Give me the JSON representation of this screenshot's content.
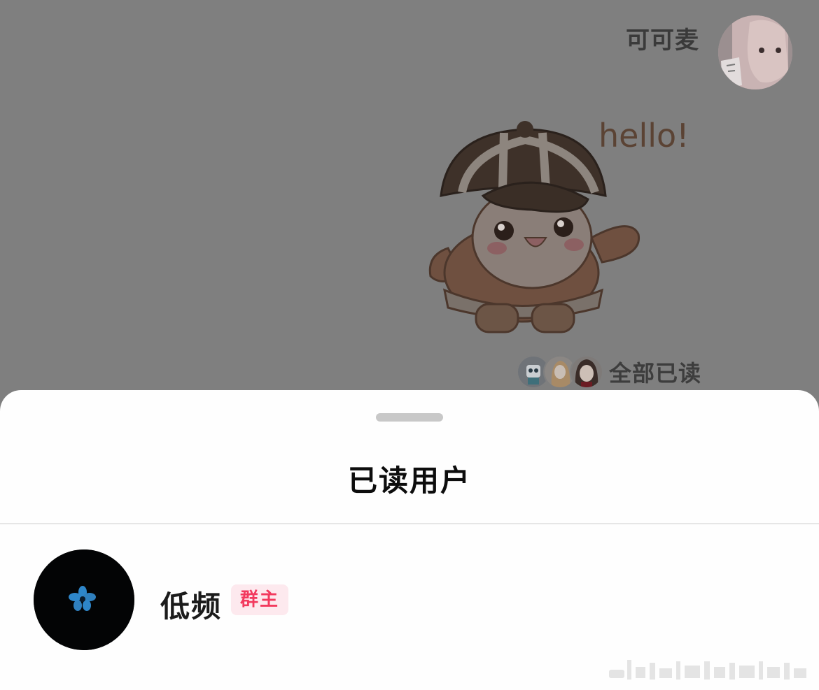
{
  "chat": {
    "sender_name": "可可麦",
    "sticker_text": "hello!",
    "read_status": "全部已读"
  },
  "sheet": {
    "title": "已读用户",
    "users": [
      {
        "name": "低频",
        "role": "群主"
      }
    ]
  },
  "colors": {
    "overlay": "#7f7f7f",
    "sheet_bg": "#fefefe",
    "badge_bg": "#fde9ee",
    "badge_text": "#f23a5e",
    "avatar_bg": "#030405",
    "flower_blue": "#2e86c9"
  }
}
